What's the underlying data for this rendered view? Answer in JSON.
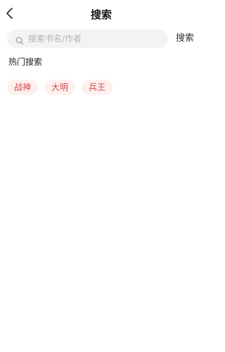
{
  "header": {
    "title": "搜索"
  },
  "search": {
    "placeholder": "搜索书名/作者",
    "value": "",
    "button_label": "搜索"
  },
  "hot_search": {
    "title": "热门搜索",
    "tags": [
      "战神",
      "大明",
      "兵王"
    ]
  },
  "colors": {
    "tag_text": "#d24b4b",
    "tag_background": "#fdf0ef",
    "search_box_background": "#f3f3f3"
  },
  "icons": {
    "back": "chevron-left-icon",
    "search": "search-icon"
  }
}
